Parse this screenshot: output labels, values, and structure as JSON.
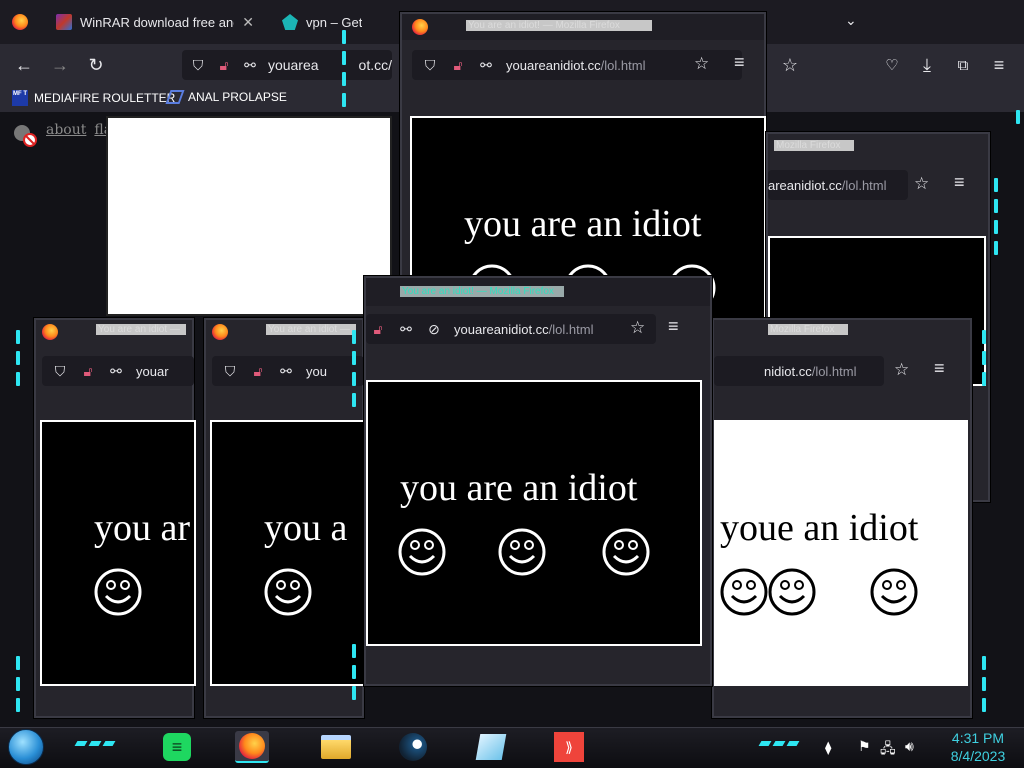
{
  "browser": {
    "tabs": [
      {
        "title": "WinRAR download free and sup",
        "icon": "winrar-icon"
      },
      {
        "title": "vpn – Get It's Ex",
        "icon": "vpn-icon"
      }
    ],
    "url": "youarea",
    "url_tail": "ot.cc/",
    "bookmarks": [
      {
        "label": "MEDIAFIRE ROULETTER",
        "icon_text": "MF T"
      },
      {
        "label": "ANAL PROLAPSE"
      }
    ]
  },
  "page": {
    "links": [
      "about",
      "flash"
    ]
  },
  "popups": {
    "title": "You are an idiot! — Mozilla Firefox",
    "title_short": "You are an idiot —",
    "title_partial": "Mozilla Firefox",
    "url_domain": "youareanidiot.cc",
    "url_path": "/lol.html",
    "url_partial_domain": "areanidiot.cc",
    "url_partial_domain2": "nidiot.cc",
    "url_short": "youar",
    "url_short2": "you",
    "message": "you are an idiot",
    "message_cut1": "you ar",
    "message_cut2": "you a",
    "message_white": "youe an idiot"
  },
  "taskbar": {
    "time": "4:31 PM",
    "date": "8/4/2023",
    "apps": [
      "spotify-icon",
      "firefox-icon",
      "file-explorer-icon",
      "steam-icon",
      "notepad-icon",
      "anydesk-icon"
    ]
  },
  "colors": {
    "accent_cyan": "#2ee6f2",
    "chrome_dark": "#1c1b22",
    "toolbar": "#2b2a33",
    "clock": "#3fd0e0"
  }
}
